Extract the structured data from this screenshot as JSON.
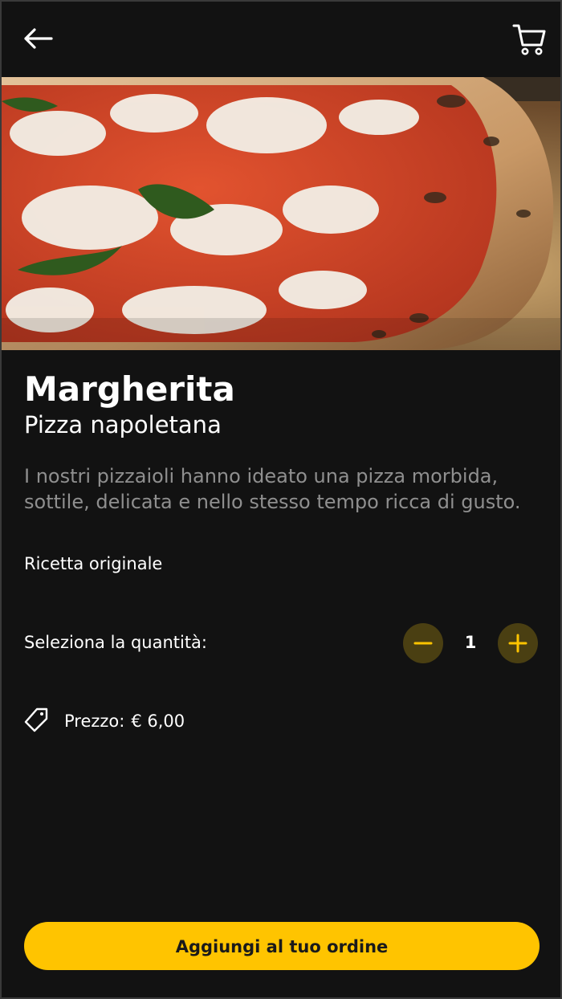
{
  "header": {
    "back_icon": "arrow-left-icon",
    "cart_icon": "cart-icon"
  },
  "product": {
    "name": "Margherita",
    "category": "Pizza napoletana",
    "description": "I nostri pizzaioli hanno ideato una pizza morbida, sottile, delicata e nello stesso tempo ricca di gusto.",
    "tag": "Ricetta originale",
    "image": "pizza-margherita-photo"
  },
  "quantity": {
    "label": "Seleziona la quantità:",
    "value": "1",
    "minus_icon": "minus-icon",
    "plus_icon": "plus-icon"
  },
  "price": {
    "label": "Prezzo:",
    "value": "€ 6,00",
    "icon": "price-tag-icon"
  },
  "cta": {
    "label": "Aggiungi al tuo ordine"
  },
  "colors": {
    "background": "#121212",
    "accent": "#ffc400",
    "qty_button_bg": "#4a3f12",
    "muted_text": "#8f8f8f"
  }
}
